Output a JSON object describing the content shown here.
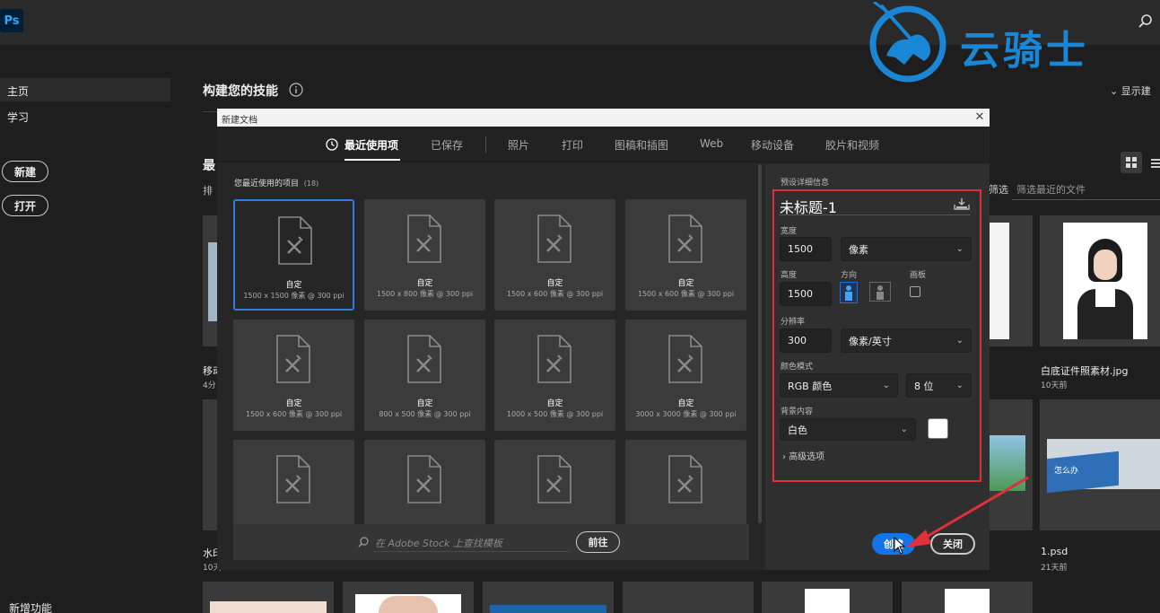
{
  "app": {
    "logo": "Ps"
  },
  "watermark": {
    "text": "云骑士"
  },
  "sidebar": {
    "home": "主页",
    "learn": "学习",
    "new_btn": "新建",
    "open_btn": "打开",
    "whats_new": "新增功能"
  },
  "home": {
    "heading": "构建您的技能",
    "show_suggestions": "显示建",
    "recent_heading": "最",
    "sort_label": "排",
    "filter": "筛选",
    "filter_placeholder": "筛选最近的文件",
    "files": [
      {
        "name": "移动",
        "time": "4分"
      },
      {
        "name": "白底证件照素材.jpg",
        "time": "10天前"
      },
      {
        "name": "水印",
        "time": "10天"
      },
      {
        "name": "1.psd",
        "time": "21天前"
      }
    ],
    "thumb_caption": "怎么办"
  },
  "dialog": {
    "title": "新建文档",
    "tabs": [
      "最近使用项",
      "已保存",
      "照片",
      "打印",
      "图稿和插图",
      "Web",
      "移动设备",
      "胶片和视频"
    ],
    "recent_label": "您最近使用的项目",
    "recent_count": "(18)",
    "presets": [
      {
        "name": "自定",
        "size": "1500 x 1500 像素 @ 300 ppi"
      },
      {
        "name": "自定",
        "size": "1500 x 800 像素 @ 300 ppi"
      },
      {
        "name": "自定",
        "size": "1500 x 600 像素 @ 300 ppi"
      },
      {
        "name": "自定",
        "size": "1500 x 600 像素 @ 300 ppi"
      },
      {
        "name": "自定",
        "size": "1500 x 600 像素 @ 300 ppi"
      },
      {
        "name": "自定",
        "size": "800 x 500 像素 @ 300 ppi"
      },
      {
        "name": "自定",
        "size": "1000 x 500 像素 @ 300 ppi"
      },
      {
        "name": "自定",
        "size": "3000 x 3000 像素 @ 300 ppi"
      },
      {
        "name": "",
        "size": ""
      },
      {
        "name": "",
        "size": ""
      },
      {
        "name": "",
        "size": ""
      },
      {
        "name": "",
        "size": ""
      }
    ],
    "stock_placeholder": "在 Adobe Stock 上查找模板",
    "go_btn": "前往",
    "details": {
      "section": "预设详细信息",
      "doc_name": "未标题-1",
      "width_label": "宽度",
      "width": "1500",
      "width_unit": "像素",
      "height_label": "高度",
      "height": "1500",
      "orientation_label": "方向",
      "artboard_label": "画板",
      "resolution_label": "分辨率",
      "resolution": "300",
      "resolution_unit": "像素/英寸",
      "color_mode_label": "颜色模式",
      "color_mode": "RGB 颜色",
      "bit_depth": "8 位",
      "bg_label": "背景内容",
      "bg": "白色",
      "bg_color": "#ffffff",
      "advanced": "高级选项"
    },
    "create_btn": "创建",
    "close_btn": "关闭"
  }
}
